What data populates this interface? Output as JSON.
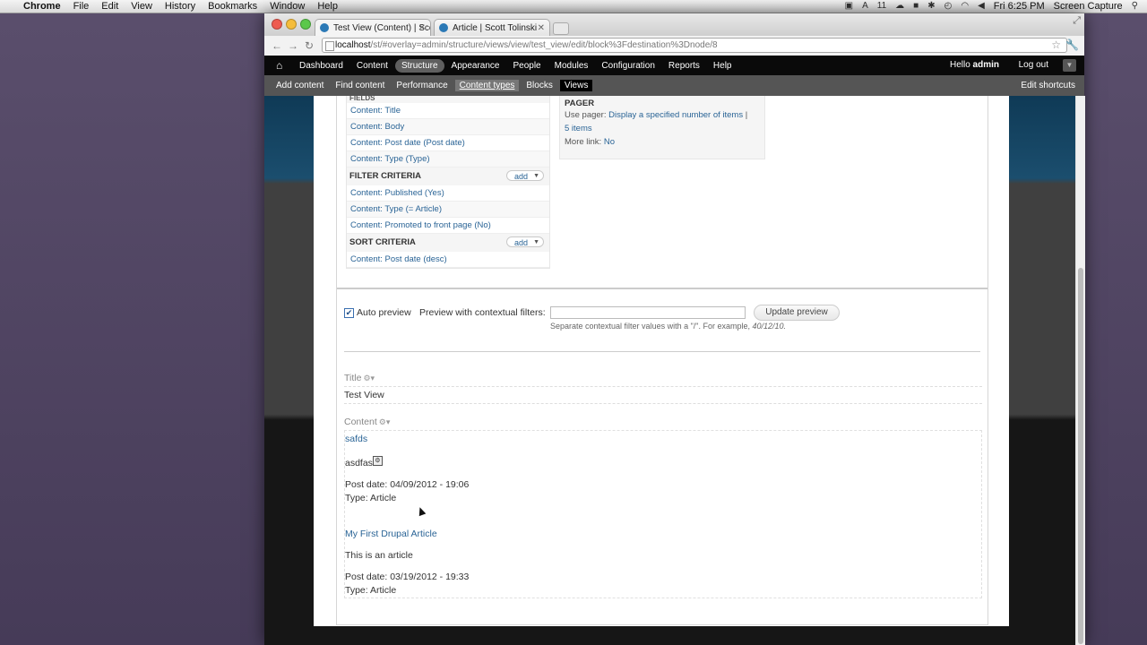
{
  "mac_menubar": {
    "app_name": "Chrome",
    "menus": [
      "File",
      "Edit",
      "View",
      "History",
      "Bookmarks",
      "Window",
      "Help"
    ],
    "status_right": {
      "battery_num": "11",
      "clock": "Fri 6:25 PM",
      "capture_app": "Screen Capture"
    }
  },
  "browser": {
    "tabs": [
      {
        "title": "Test View (Content) | Scott T",
        "active": true
      },
      {
        "title": "Article | Scott Tolinski",
        "active": false
      }
    ],
    "url_host": "localhost",
    "url_rest": "/st/#overlay=admin/structure/views/view/test_view/edit/block%3Fdestination%3Dnode/8"
  },
  "admin_toolbar": {
    "menu": [
      "Dashboard",
      "Content",
      "Structure",
      "Appearance",
      "People",
      "Modules",
      "Configuration",
      "Reports",
      "Help"
    ],
    "active": "Structure",
    "hello": "Hello",
    "username": "admin",
    "logout": "Log out"
  },
  "shortcuts": {
    "items": [
      "Add content",
      "Find content",
      "Performance",
      "Content types",
      "Blocks",
      "Views"
    ],
    "highlighted": "Content types",
    "active": "Views",
    "edit": "Edit shortcuts"
  },
  "views_ui": {
    "fields_label": "FIELDS",
    "fields": [
      "Content: Title",
      "Content: Body",
      "Content: Post date (Post date)",
      "Content: Type (Type)"
    ],
    "filter_label": "FILTER CRITERIA",
    "filters": [
      "Content: Published (Yes)",
      "Content: Type (= Article)",
      "Content: Promoted to front page (No)"
    ],
    "sort_label": "SORT CRITERIA",
    "sorts": [
      "Content: Post date (desc)"
    ],
    "add_label": "add",
    "pager": {
      "title": "PAGER",
      "use_pager_label": "Use pager:",
      "use_pager_value": "Display a specified number of items",
      "separator": "|",
      "items_value": "5 items",
      "more_link_label": "More link:",
      "more_link_value": "No"
    }
  },
  "preview_controls": {
    "auto_preview_label": "Auto preview",
    "auto_preview_checked": true,
    "contextual_label": "Preview with contextual filters:",
    "contextual_value": "",
    "update_button": "Update preview",
    "help_text": "Separate contextual filter values with a \"/\". For example,",
    "help_example": "40/12/10."
  },
  "preview": {
    "title_area_label": "Title",
    "title_value": "Test View",
    "content_area_label": "Content",
    "nodes": [
      {
        "title": "safds",
        "body": "asdfas",
        "post_date": "Post date: 04/09/2012 - 19:06",
        "type": "Type: Article"
      },
      {
        "title": "My First Drupal Article",
        "body": "This is an article",
        "post_date": "Post date: 03/19/2012 - 19:33",
        "type": "Type: Article"
      }
    ]
  }
}
